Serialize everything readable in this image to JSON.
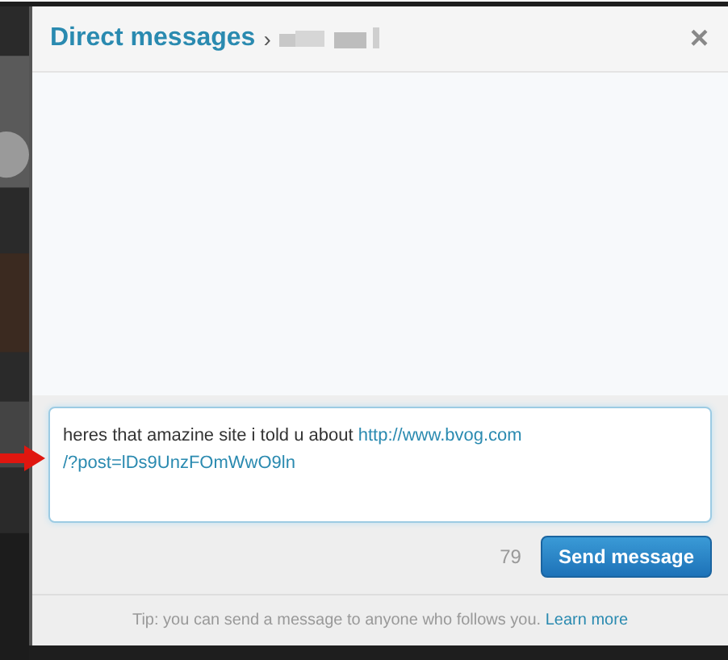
{
  "dialog": {
    "title": "Direct messages",
    "separator": "›",
    "close": "×"
  },
  "composer": {
    "value": "heres that amazine site i told u about ",
    "link_lines": [
      "http://www.bvog.com",
      "/?post=lDs9UnzFOmWwO9ln"
    ],
    "remaining": "79",
    "button": "Send message"
  },
  "tip": {
    "text": "Tip: you can send a message to anyone who follows you.",
    "link": "Learn more"
  }
}
